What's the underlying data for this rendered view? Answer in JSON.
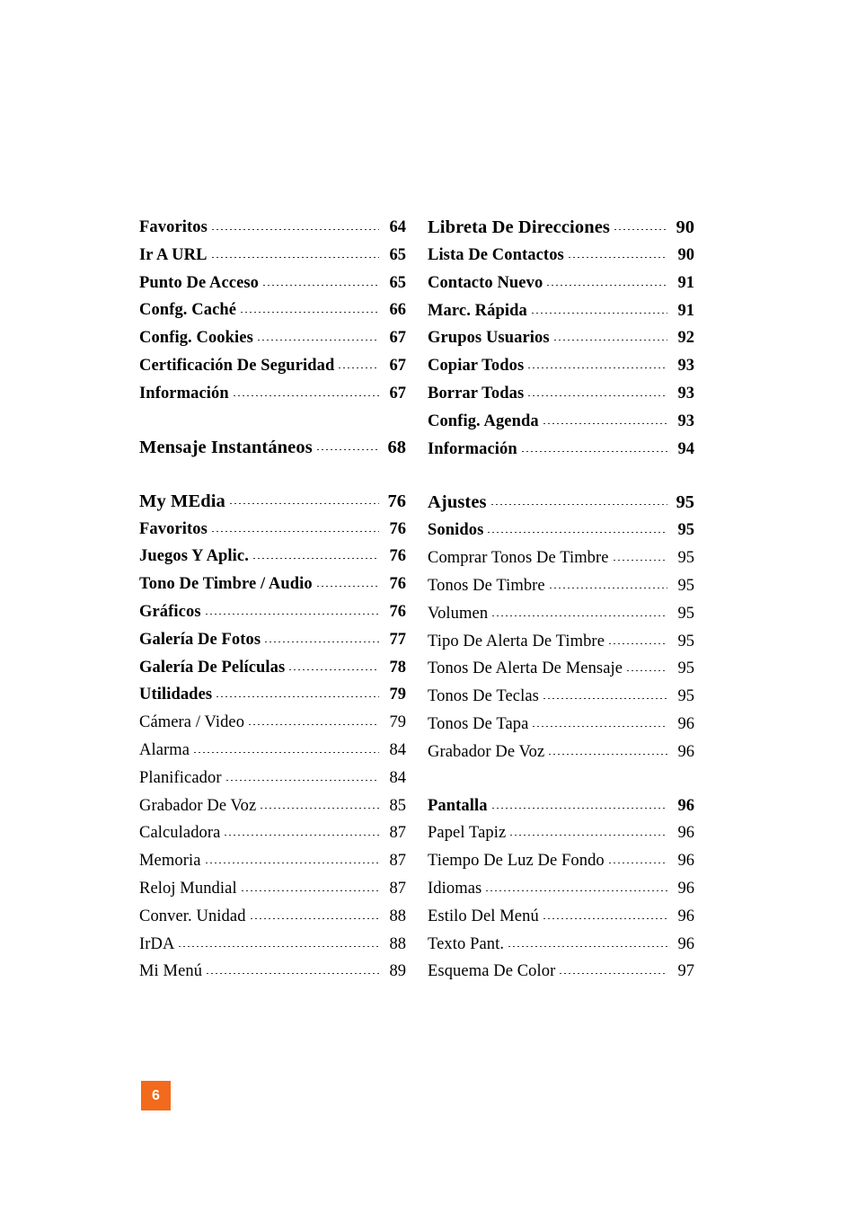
{
  "page_badge": {
    "number": "6",
    "background_color": "#F26A1B",
    "text_color": "#FFFFFF"
  },
  "toc": {
    "left_column": [
      {
        "group_id": "browser-group",
        "entries": [
          {
            "label": "Favoritos",
            "page": "64",
            "style": "bold"
          },
          {
            "label": "Ir A URL",
            "page": "65",
            "style": "bold"
          },
          {
            "label": "Punto De Acceso",
            "page": "65",
            "style": "bold"
          },
          {
            "label": "Confg. Caché",
            "page": "66",
            "style": "bold"
          },
          {
            "label": "Config. Cookies",
            "page": "67",
            "style": "bold"
          },
          {
            "label": "Certificación De Seguridad",
            "page": "67",
            "style": "bold"
          },
          {
            "label": "Información",
            "page": "67",
            "style": "bold"
          }
        ]
      },
      {
        "group_id": "mensaje-instantaneos-group",
        "entries": [
          {
            "label": "Mensaje Instantáneos",
            "page": "68",
            "style": "header"
          }
        ]
      },
      {
        "group_id": "my-media-group",
        "entries": [
          {
            "label": "My MEdia",
            "page": "76",
            "style": "header"
          },
          {
            "label": "Favoritos",
            "page": "76",
            "style": "bold"
          },
          {
            "label": "Juegos Y Aplic.",
            "page": "76",
            "style": "bold"
          },
          {
            "label": "Tono De Timbre / Audio",
            "page": "76",
            "style": "bold"
          },
          {
            "label": "Gráficos",
            "page": "76",
            "style": "bold"
          },
          {
            "label": "Galería De Fotos",
            "page": "77",
            "style": "bold"
          },
          {
            "label": "Galería De Películas",
            "page": "78",
            "style": "bold"
          },
          {
            "label": "Utilidades",
            "page": "79",
            "style": "bold"
          },
          {
            "label": "Cámera / Video",
            "page": "79",
            "style": "normal"
          },
          {
            "label": "Alarma",
            "page": "84",
            "style": "normal"
          },
          {
            "label": "Planificador",
            "page": "84",
            "style": "normal"
          },
          {
            "label": "Grabador De Voz",
            "page": "85",
            "style": "normal"
          },
          {
            "label": "Calculadora",
            "page": "87",
            "style": "normal"
          },
          {
            "label": "Memoria",
            "page": "87",
            "style": "normal"
          },
          {
            "label": "Reloj Mundial",
            "page": "87",
            "style": "normal"
          },
          {
            "label": "Conver. Unidad",
            "page": "88",
            "style": "normal"
          },
          {
            "label": "IrDA",
            "page": "88",
            "style": "normal"
          },
          {
            "label": "Mi Menú",
            "page": "89",
            "style": "normal"
          }
        ]
      }
    ],
    "right_column": [
      {
        "group_id": "libreta-de-direcciones-group",
        "entries": [
          {
            "label": "Libreta De Direcciones",
            "page": "90",
            "style": "header"
          },
          {
            "label": "Lista De Contactos",
            "page": "90",
            "style": "bold"
          },
          {
            "label": "Contacto Nuevo",
            "page": "91",
            "style": "bold"
          },
          {
            "label": "Marc. Rápida",
            "page": "91",
            "style": "bold"
          },
          {
            "label": "Grupos Usuarios",
            "page": "92",
            "style": "bold"
          },
          {
            "label": "Copiar Todos",
            "page": "93",
            "style": "bold"
          },
          {
            "label": "Borrar Todas",
            "page": "93",
            "style": "bold"
          },
          {
            "label": "Config. Agenda",
            "page": "93",
            "style": "bold"
          },
          {
            "label": "Información",
            "page": "94",
            "style": "bold"
          }
        ]
      },
      {
        "group_id": "ajustes-group",
        "entries": [
          {
            "label": "Ajustes",
            "page": "95",
            "style": "header"
          },
          {
            "label": "Sonidos",
            "page": "95",
            "style": "bold"
          },
          {
            "label": "Comprar Tonos De Timbre",
            "page": "95",
            "style": "normal"
          },
          {
            "label": "Tonos De Timbre",
            "page": "95",
            "style": "normal"
          },
          {
            "label": "Volumen",
            "page": "95",
            "style": "normal"
          },
          {
            "label": "Tipo De Alerta De Timbre",
            "page": "95",
            "style": "normal"
          },
          {
            "label": "Tonos De Alerta De Mensaje",
            "page": "95",
            "style": "normal"
          },
          {
            "label": "Tonos De Teclas",
            "page": "95",
            "style": "normal"
          },
          {
            "label": "Tonos De Tapa",
            "page": "96",
            "style": "normal"
          },
          {
            "label": "Grabador De Voz",
            "page": "96",
            "style": "normal"
          }
        ]
      },
      {
        "group_id": "pantalla-group",
        "entries": [
          {
            "label": "Pantalla",
            "page": "96",
            "style": "bold"
          },
          {
            "label": "Papel Tapiz",
            "page": "96",
            "style": "normal"
          },
          {
            "label": "Tiempo De Luz De Fondo",
            "page": "96",
            "style": "normal"
          },
          {
            "label": "Idiomas",
            "page": "96",
            "style": "normal"
          },
          {
            "label": "Estilo Del Menú",
            "page": "96",
            "style": "normal"
          },
          {
            "label": "Texto Pant.",
            "page": "96",
            "style": "normal"
          },
          {
            "label": "Esquema De Color",
            "page": "97",
            "style": "normal"
          }
        ]
      }
    ]
  }
}
